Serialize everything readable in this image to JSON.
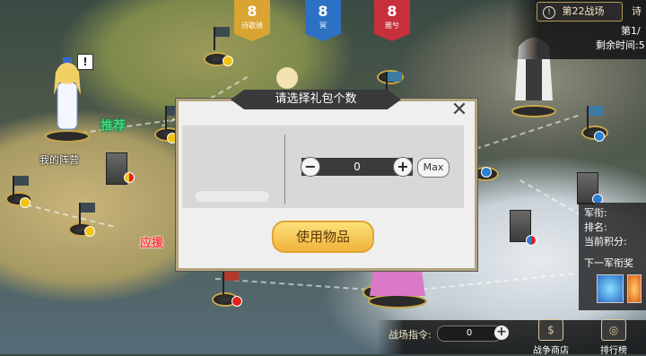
{
  "top_badges": [
    {
      "value": "8",
      "label": "诗歌骑",
      "color": "#d9a431"
    },
    {
      "value": "8",
      "label": "冥",
      "color": "#2d71c4"
    },
    {
      "value": "8",
      "label": "雅兮",
      "color": "#c7303a"
    }
  ],
  "battlefield": {
    "tab_label": "第22战场",
    "tab2_label": "诗",
    "progress": "第1/",
    "remaining": "剩余时间:5"
  },
  "map_labels": {
    "camp": "我的阵营",
    "support": "应援",
    "recommend": "推荐"
  },
  "right_panel": {
    "rank": "军衔:",
    "place": "排名:",
    "points": "当前积分:",
    "next_rank": "下一军衔奖"
  },
  "bottom": {
    "command_label": "战场指令:",
    "command_value": "0",
    "shop_label": "战争商店",
    "leaderboard_label": "排行榜"
  },
  "dialog": {
    "title": "请选择礼包个数",
    "quantity": "0",
    "max_label": "Max",
    "use_label": "使用物品"
  },
  "icons": {
    "close": "close-icon",
    "minus": "minus-icon",
    "plus": "plus-icon",
    "alert": "alert-icon"
  }
}
